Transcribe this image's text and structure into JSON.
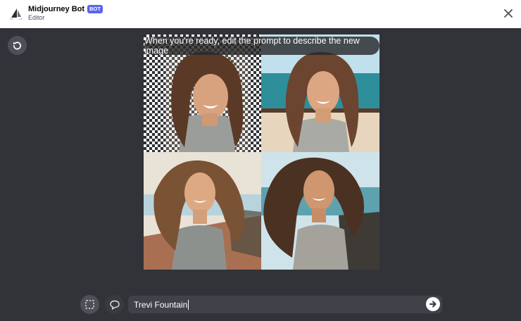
{
  "header": {
    "bot_name": "Midjourney Bot",
    "badge": "BOT",
    "subtitle": "Editor"
  },
  "editor": {
    "tooltip": "When you're ready, edit the prompt to describe the new image",
    "prompt_value": "Trevi Fountain",
    "prompt_placeholder": ""
  },
  "icons": {
    "avatar": "midjourney-sailboat-icon",
    "close": "close-icon",
    "reset": "undo-icon",
    "select": "rectangle-select-icon",
    "chat": "speech-bubble-icon",
    "send": "arrow-right-icon"
  },
  "colors": {
    "background": "#313338",
    "header_bg": "#ffffff",
    "badge": "#5865f2",
    "input_bg": "#404249"
  }
}
